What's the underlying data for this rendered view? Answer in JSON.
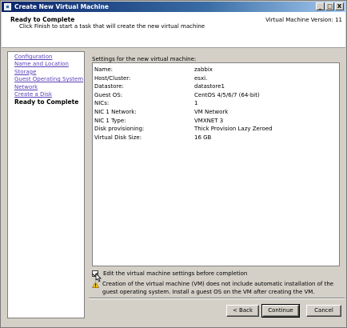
{
  "window": {
    "title": "Create New Virtual Machine"
  },
  "header": {
    "title": "Ready to Complete",
    "subtitle": "Click Finish to start a task that will create the new virtual machine",
    "version": "Virtual Machine Version: 11"
  },
  "nav": {
    "items": [
      {
        "label": "Configuration"
      },
      {
        "label": "Name and Location"
      },
      {
        "label": "Storage"
      },
      {
        "label": "Guest Operating System"
      },
      {
        "label": "Network"
      },
      {
        "label": "Create a Disk"
      },
      {
        "label": "Ready to Complete"
      }
    ]
  },
  "settings": {
    "caption": "Settings for the new virtual machine:",
    "rows": [
      {
        "key": "Name:",
        "value": "zabbix"
      },
      {
        "key": "Host/Cluster:",
        "value": "esxi."
      },
      {
        "key": "Datastore:",
        "value": "datastore1"
      },
      {
        "key": "Guest OS:",
        "value": "CentOS 4/5/6/7 (64-bit)"
      },
      {
        "key": "NICs:",
        "value": "1"
      },
      {
        "key": "NIC 1 Network:",
        "value": "VM Network"
      },
      {
        "key": "NIC 1 Type:",
        "value": "VMXNET 3"
      },
      {
        "key": "Disk provisioning:",
        "value": "Thick Provision Lazy Zeroed"
      },
      {
        "key": "Virtual Disk Size:",
        "value": "16 GB"
      }
    ]
  },
  "edit_checkbox": {
    "label": "Edit the virtual machine settings before completion",
    "checked": true
  },
  "warning": {
    "text": "Creation of the virtual machine (VM) does not include automatic installation of the guest operating system. Install a guest OS on the VM after creating the VM."
  },
  "buttons": {
    "back": "< Back",
    "continue": "Continue",
    "cancel": "Cancel"
  },
  "titlebar_buttons": {
    "minimize": "_",
    "maximize": "□",
    "close": "X"
  }
}
